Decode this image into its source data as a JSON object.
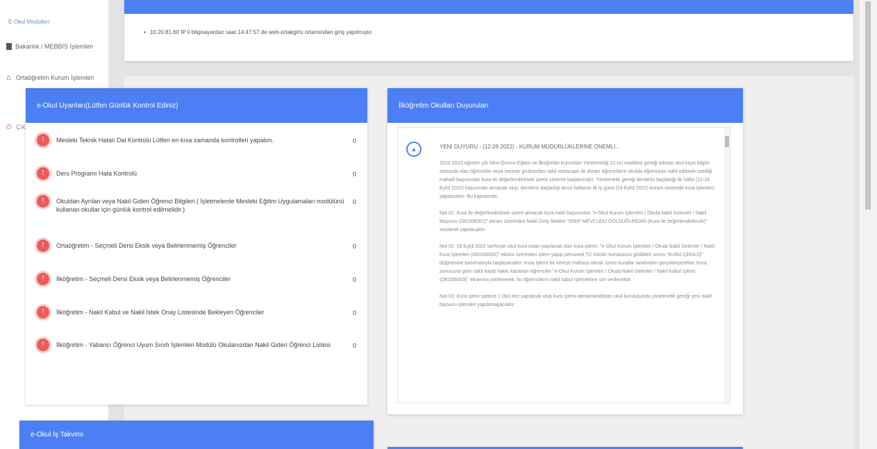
{
  "sidebar": {
    "title": "E-Okul Modülleri",
    "items": [
      {
        "label": "Bakanlık / MEBBİS İşlemleri",
        "icon": "book-icon"
      },
      {
        "label": "Ortaöğretim Kurum İşlemleri",
        "icon": "school-icon"
      },
      {
        "label": "Çıkış",
        "icon": "power-icon"
      }
    ]
  },
  "top": {
    "login_message": "10.20.81.60 IP li bilgisayardan saat 14:47:57 de web-ortakgiris ortamından giriş yapılmıştır."
  },
  "warnings": {
    "title": "e-Okul Uyarıları(Lütfen Günlük Kontrol Ediniz)",
    "items": [
      {
        "text": "Mesleki Teknik Hatalı Dal Kontrolü Lütfen en kısa zamanda kontrolleri yapalım.",
        "count": "0"
      },
      {
        "text": "Ders Programı Hata Kontrolü",
        "count": "0"
      },
      {
        "text": "Okuldan Ayrılan veya Nakil Giden Öğrenci Bilgileri ( İşletmelerde Mesleki Eğitim Uygulamaları modülünü kullanan okullar için günlük kontrol edilmelidir.)",
        "count": "0"
      },
      {
        "text": "Ortaöğretim - Seçmeli Dersi Eksik veya Belirlenmemiş Öğrenciler",
        "count": "0"
      },
      {
        "text": "İlköğretim - Seçmeli Dersi Eksik veya Belirlenmemiş Öğrenciler",
        "count": "0"
      },
      {
        "text": "İlköğretim - Nakil Kabul ve Nakil İstek Onay Listesinde Bekleyen Öğrenciler",
        "count": "0"
      },
      {
        "text": "İlköğretim - Yabancı Öğrenci Uyum Sınıfı İşlemleri Modülü Okulanızdan Nakil Gideri Öğrenci Listesi",
        "count": "0"
      }
    ]
  },
  "announcements": {
    "title": "İlköğretim Okulları Duyuruları",
    "heading": "YENİ DUYURU - (12.09.2022) - KURUM MÜDÜRLÜKLERİNE ÖNEMLİ...",
    "paragraphs": [
      "2022-2023 öğretim yılı Okul Öncesi Eğitim ve İlköğretim Kurumları Yönetmeliği 12 nci maddesi gereği adrese okul kayıt bilgisi sonunda olan öğrenciler veya mezner grubundan nakil müracaatı ile alınan öğrencilerin okulda öğrencinin nakil edilmek istediği mahalli başvuruları kura ile değerlendirilmek üzere sisteme başlanmıştır. Yönetmelik gereği derslerin başladığı ilk hafta (12-16 Eylül 2022) başvurular alınacak olup, derslerin başladığı ikinci haftanın ilk iş günü (19 Eylül 2022) kurum sistemde kura işlemleri yapılacaktır. Bu kapsamda:",
      "Not 01: Kura ile değerlendirilmek üzere alınacak kura nakil başvuruları \"e-Okul Kurum İşlemleri / Okula Nakil Gelenler / Nakil Başvuru (OKD06001)\" ekranı üzerinden Nakil Giriş Nedeni \"SINIF MEVCUDU DOLDUĞUNDAN (Kura ile değerlendirilecek)\" seçilerek yapılacaktır.",
      "Not 02: 19 Eylül 2022 tarihinde okul kura'ından yapılacak olan kura işlemi, \"e-Okul Kurum İşlemleri / Okula Nakil Gelenler / Nakil Kura İşlemleri (OKD06002)\" ekranı üzerinden işlem yapıp personeli TC Kimlik numarasını girdikten sonra \"KURA ÇEKİLİŞ\" düğmesine basılmasıyla başlayacaktır. Kura işlemi bir kereye mahsus olmak üzere kurallar tarafından gerçekleşecektir. Kura sonucuna göre nakil kaydı hakkı kazanan öğrenciler \"e-Okul Kurum İşlemleri / Okula Nakil Gelenler / Nakil Kabul İşlemi (OKD06003)\" ekranına yönlenerek, bu öğrencilerin nakil kabul işlemlerine izin verilecektir.",
      "Not 03: Kura işlem sadece 1 (bir) kez yapılacak olup kura işlemi tamamlandıktan okul kuruluşunda yönetmelik gereği yeni nakil başvuru işlemleri yapılamayacaktır."
    ]
  },
  "calendar": {
    "title": "e-Okul İş Takvimi"
  },
  "colors": {
    "accent": "#4b7ff3",
    "warning": "#ec5a5a",
    "annotation_arrow": "#c0392b"
  }
}
